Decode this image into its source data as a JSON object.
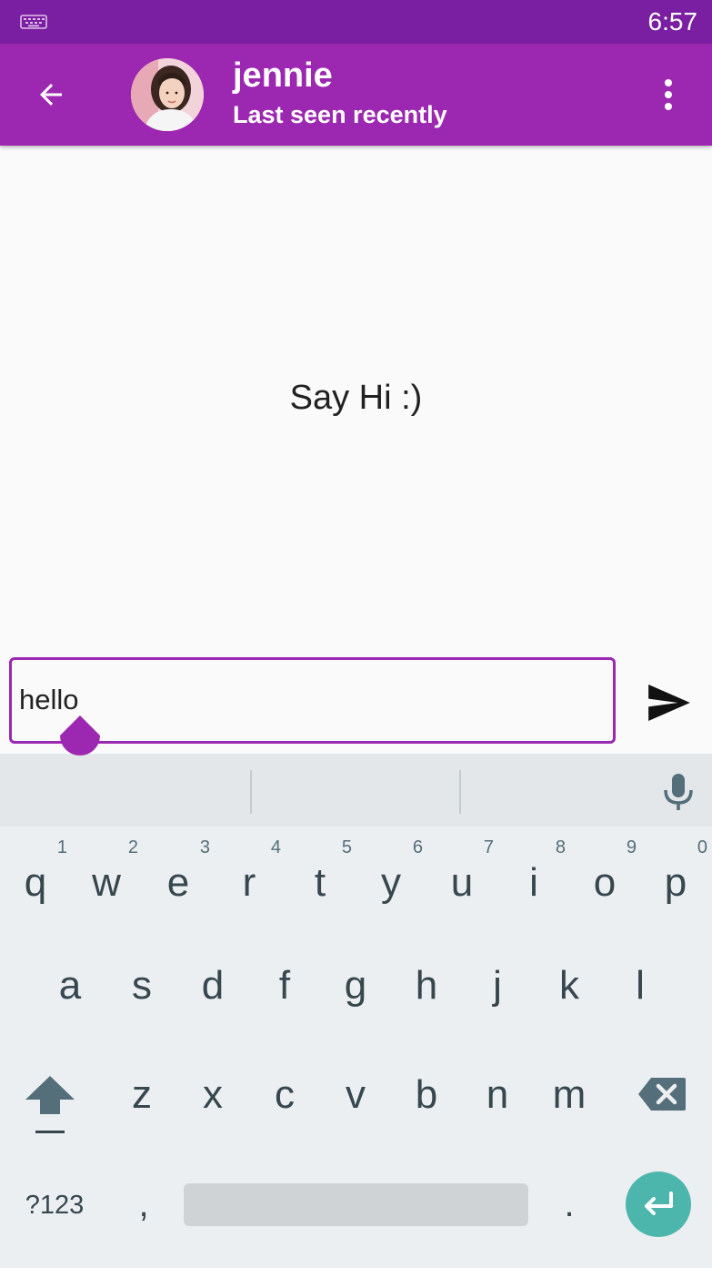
{
  "status_bar": {
    "time": "6:57",
    "left_icon": "keyboard-icon"
  },
  "app_bar": {
    "back_icon": "arrow-back-icon",
    "contact_name": "jennie",
    "contact_status": "Last seen recently",
    "more_icon": "more-vertical-icon"
  },
  "chat": {
    "empty_message": "Say Hi :)"
  },
  "composer": {
    "value": "hello",
    "send_icon": "send-icon"
  },
  "keyboard": {
    "row1": [
      {
        "key": "q",
        "hint": "1"
      },
      {
        "key": "w",
        "hint": "2"
      },
      {
        "key": "e",
        "hint": "3"
      },
      {
        "key": "r",
        "hint": "4"
      },
      {
        "key": "t",
        "hint": "5"
      },
      {
        "key": "y",
        "hint": "6"
      },
      {
        "key": "u",
        "hint": "7"
      },
      {
        "key": "i",
        "hint": "8"
      },
      {
        "key": "o",
        "hint": "9"
      },
      {
        "key": "p",
        "hint": "0"
      }
    ],
    "row2": [
      "a",
      "s",
      "d",
      "f",
      "g",
      "h",
      "j",
      "k",
      "l"
    ],
    "row3": [
      "z",
      "x",
      "c",
      "v",
      "b",
      "n",
      "m"
    ],
    "symbols_label": "?123",
    "comma_label": ",",
    "period_label": ".",
    "mic_icon": "mic-icon",
    "shift_icon": "shift-icon",
    "backspace_icon": "backspace-icon",
    "enter_icon": "enter-icon"
  },
  "colors": {
    "status_bar": "#7b1fa2",
    "app_bar": "#9c27b0",
    "accent": "#9c27b0",
    "enter_key": "#4db6ac",
    "keyboard_bg": "#eceff1"
  }
}
